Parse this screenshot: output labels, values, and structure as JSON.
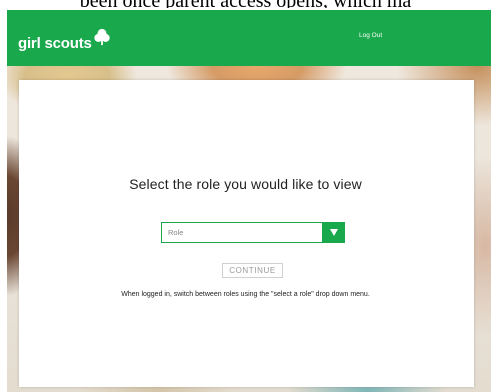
{
  "top_text": "been once parent access opens, which ma",
  "header": {
    "logo_text": "girl scouts",
    "logout_label": "Log Out",
    "bg_color": "#1aa84d"
  },
  "modal": {
    "title": "Select the role you would like to view",
    "role_select": {
      "value": "Role",
      "icon": "triangle-down-icon"
    },
    "continue_label": "CONTINUE",
    "help_text": "When logged in, switch between roles using the \"select a role\" drop down menu."
  },
  "colors": {
    "brand_green": "#1aa84d",
    "text_dark": "#222222",
    "button_border": "#d0d0d0"
  }
}
